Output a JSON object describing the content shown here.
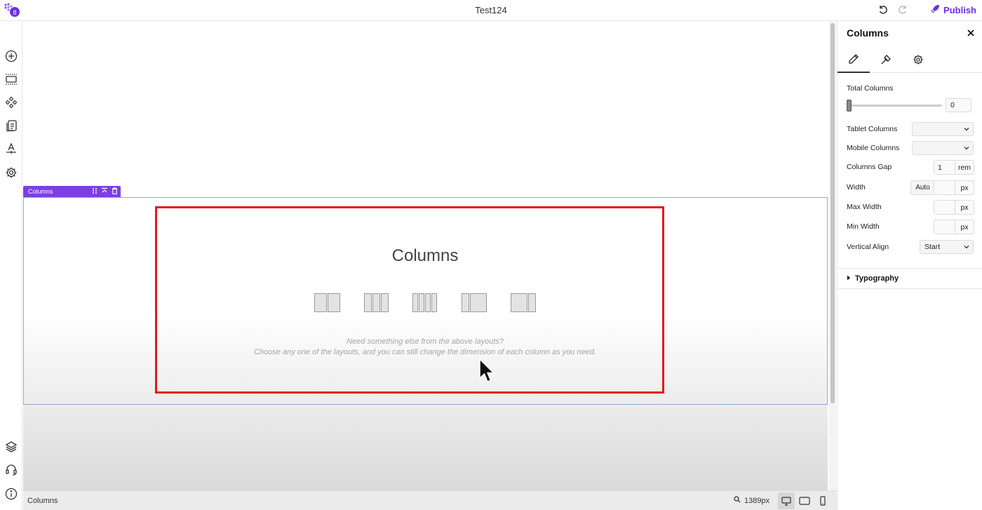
{
  "app": {
    "title": "Test124",
    "publish_label": "Publish",
    "accent_color": "#6b2fe0",
    "icons": {
      "logo": "brand-logo-icon",
      "undo": "undo-icon",
      "redo": "redo-icon",
      "publish": "rocket-icon"
    }
  },
  "left_toolbar": {
    "top_items": [
      {
        "name": "add-element",
        "icon": "plus-circle-icon"
      },
      {
        "name": "section",
        "icon": "section-icon"
      },
      {
        "name": "components",
        "icon": "components-icon"
      },
      {
        "name": "pages",
        "icon": "pages-icon"
      },
      {
        "name": "typography",
        "icon": "text-style-icon"
      },
      {
        "name": "settings",
        "icon": "gear-icon"
      }
    ],
    "bottom_items": [
      {
        "name": "layers",
        "icon": "layers-icon"
      },
      {
        "name": "support",
        "icon": "headset-icon"
      },
      {
        "name": "info",
        "icon": "info-icon"
      }
    ]
  },
  "canvas": {
    "element_tag": "Columns",
    "block": {
      "heading": "Columns",
      "layout_options": [
        "2 columns",
        "3 columns",
        "4 columns",
        "1/3 + 2/3",
        "2/3 + 1/3"
      ],
      "hint_line1": "Need something else from the above layouts?",
      "hint_line2": "Choose any one of the layouts, and you can still change the dimension of each column as you need."
    },
    "highlight_color": "#e8161e",
    "selection_color": "#7b3fe4"
  },
  "bottombar": {
    "breadcrumb": "Columns",
    "zoom_value": "1389px",
    "devices": [
      {
        "name": "desktop",
        "icon": "desktop-icon",
        "active": true
      },
      {
        "name": "tablet",
        "icon": "tablet-icon",
        "active": false
      },
      {
        "name": "mobile",
        "icon": "mobile-icon",
        "active": false
      }
    ]
  },
  "panel": {
    "title": "Columns",
    "tabs": [
      {
        "name": "edit",
        "icon": "pencil-icon",
        "active": true
      },
      {
        "name": "style",
        "icon": "brush-icon",
        "active": false
      },
      {
        "name": "advanced",
        "icon": "gear-icon",
        "active": false
      }
    ],
    "total_columns": {
      "label": "Total Columns",
      "value": "0",
      "slider_fraction": 0
    },
    "tablet_columns": {
      "label": "Tablet Columns",
      "value": ""
    },
    "mobile_columns": {
      "label": "Mobile Columns",
      "value": ""
    },
    "columns_gap": {
      "label": "Columns Gap",
      "value": "1",
      "unit": "rem"
    },
    "width": {
      "label": "Width",
      "auto_label": "Auto",
      "value": "",
      "unit": "px"
    },
    "max_width": {
      "label": "Max Width",
      "value": "",
      "unit": "px"
    },
    "min_width": {
      "label": "Min Width",
      "value": "",
      "unit": "px"
    },
    "vertical_align": {
      "label": "Vertical Align",
      "value": "Start"
    },
    "typography_label": "Typography"
  }
}
